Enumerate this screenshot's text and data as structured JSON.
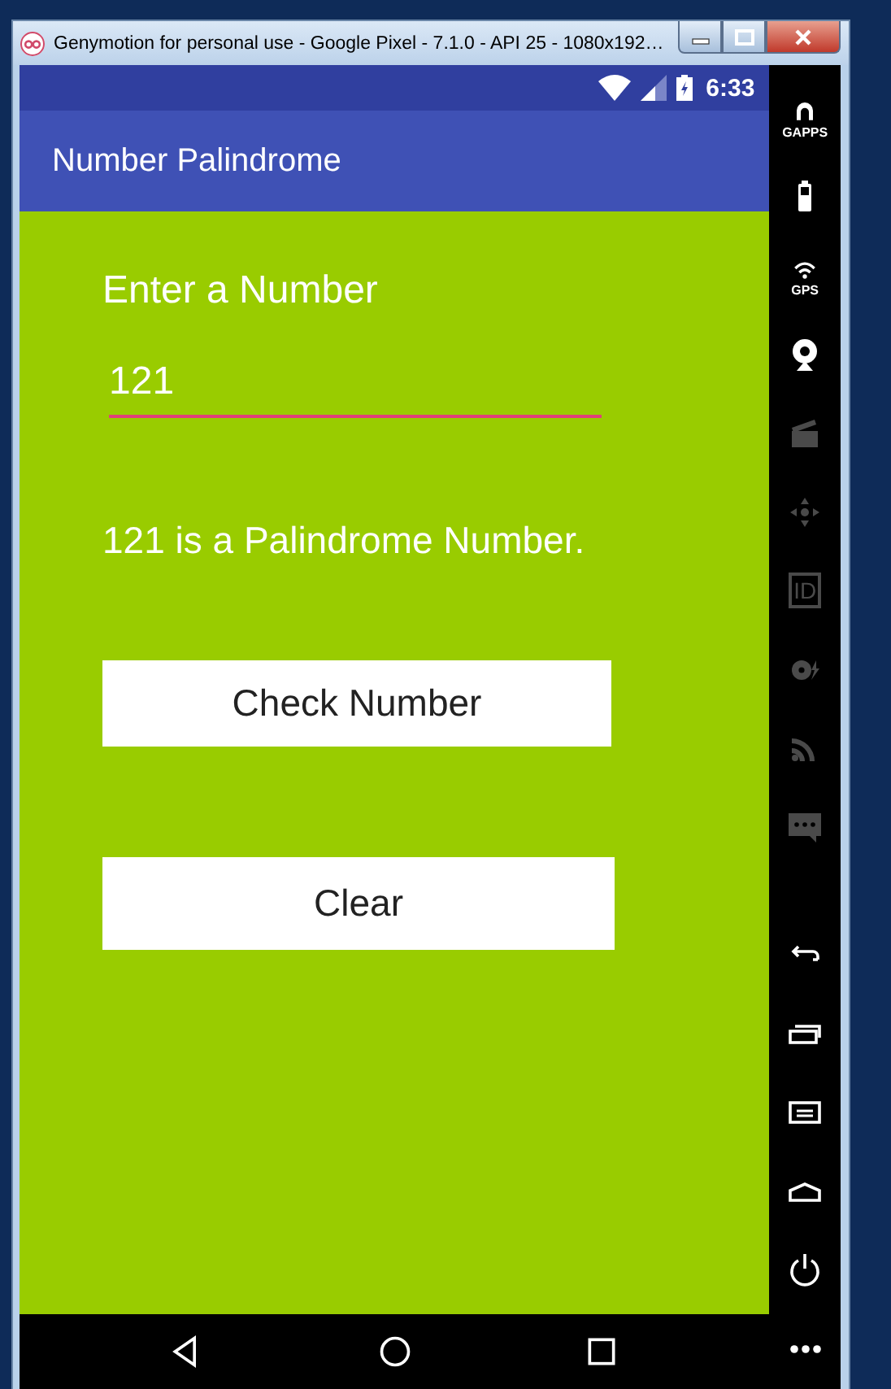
{
  "window": {
    "title": "Genymotion for personal use - Google Pixel - 7.1.0 - API 25 - 1080x192…",
    "controls": [
      {
        "kind": "minimize"
      },
      {
        "kind": "maximize"
      },
      {
        "kind": "close"
      }
    ]
  },
  "status_bar": {
    "time": "6:33",
    "icons": [
      {
        "kind": "wifi"
      },
      {
        "kind": "signal"
      },
      {
        "kind": "battery"
      }
    ]
  },
  "app_bar": {
    "title": "Number Palindrome"
  },
  "form": {
    "prompt": "Enter a Number",
    "field": {
      "value": "121"
    },
    "result": "121 is a Palindrome Number.",
    "buttons": [
      "Check Number",
      "Clear"
    ]
  },
  "nav_bar": [
    {
      "kind": "back"
    },
    {
      "kind": "home"
    },
    {
      "kind": "recents"
    }
  ],
  "device_tools": [
    {
      "kind": "gapps",
      "label": "GAPPS",
      "disabled": false
    },
    {
      "kind": "battery",
      "disabled": false
    },
    {
      "kind": "gps",
      "label": "GPS",
      "disabled": false
    },
    {
      "kind": "webcam",
      "disabled": false
    },
    {
      "kind": "clapper",
      "disabled": true
    },
    {
      "kind": "dpad",
      "disabled": true
    },
    {
      "kind": "id",
      "label": "ID",
      "disabled": true
    },
    {
      "kind": "disk",
      "disabled": true
    },
    {
      "kind": "rss",
      "disabled": true
    },
    {
      "kind": "sms",
      "disabled": true
    }
  ],
  "device_keys": [
    {
      "kind": "back"
    },
    {
      "kind": "recents"
    },
    {
      "kind": "menu"
    },
    {
      "kind": "home"
    },
    {
      "kind": "power"
    },
    {
      "kind": "more"
    }
  ]
}
